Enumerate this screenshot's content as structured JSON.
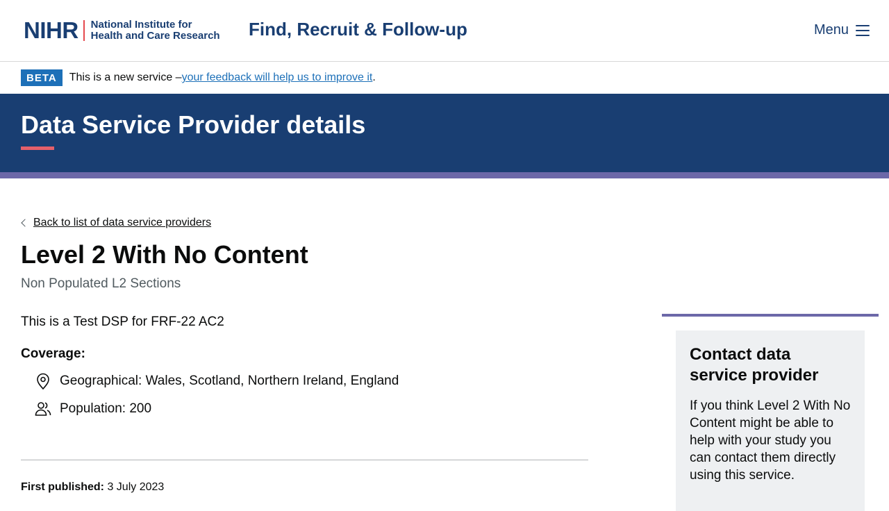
{
  "header": {
    "logo_mark": "NIHR",
    "logo_text_line1": "National Institute for",
    "logo_text_line2": "Health and Care Research",
    "service_name": "Find, Recruit & Follow-up",
    "menu_label": "Menu"
  },
  "beta": {
    "tag": "BETA",
    "text_before": "This is a new service – ",
    "link_text": "your feedback will help us to improve it",
    "text_after": "."
  },
  "banner": {
    "title": "Data Service Provider details"
  },
  "main": {
    "back_link": "Back to list of data service providers",
    "title": "Level 2 With No Content",
    "subtitle": "Non Populated L2 Sections",
    "description": "This is a Test DSP for FRF-22 AC2",
    "coverage_label": "Coverage:",
    "geographical": "Geographical: Wales, Scotland, Northern Ireland, England",
    "population": "Population: 200",
    "published_label": "First published:",
    "published_date": "3 July 2023"
  },
  "sidebar": {
    "contact_title": "Contact data service provider",
    "contact_text": "If you think Level 2 With No Content might be able to help with your study you can contact them directly using this service."
  },
  "colors": {
    "brand_navy": "#193e72",
    "beta_blue": "#1d70b8",
    "accent_red": "#e5606a",
    "accent_purple": "#6c68a8"
  }
}
